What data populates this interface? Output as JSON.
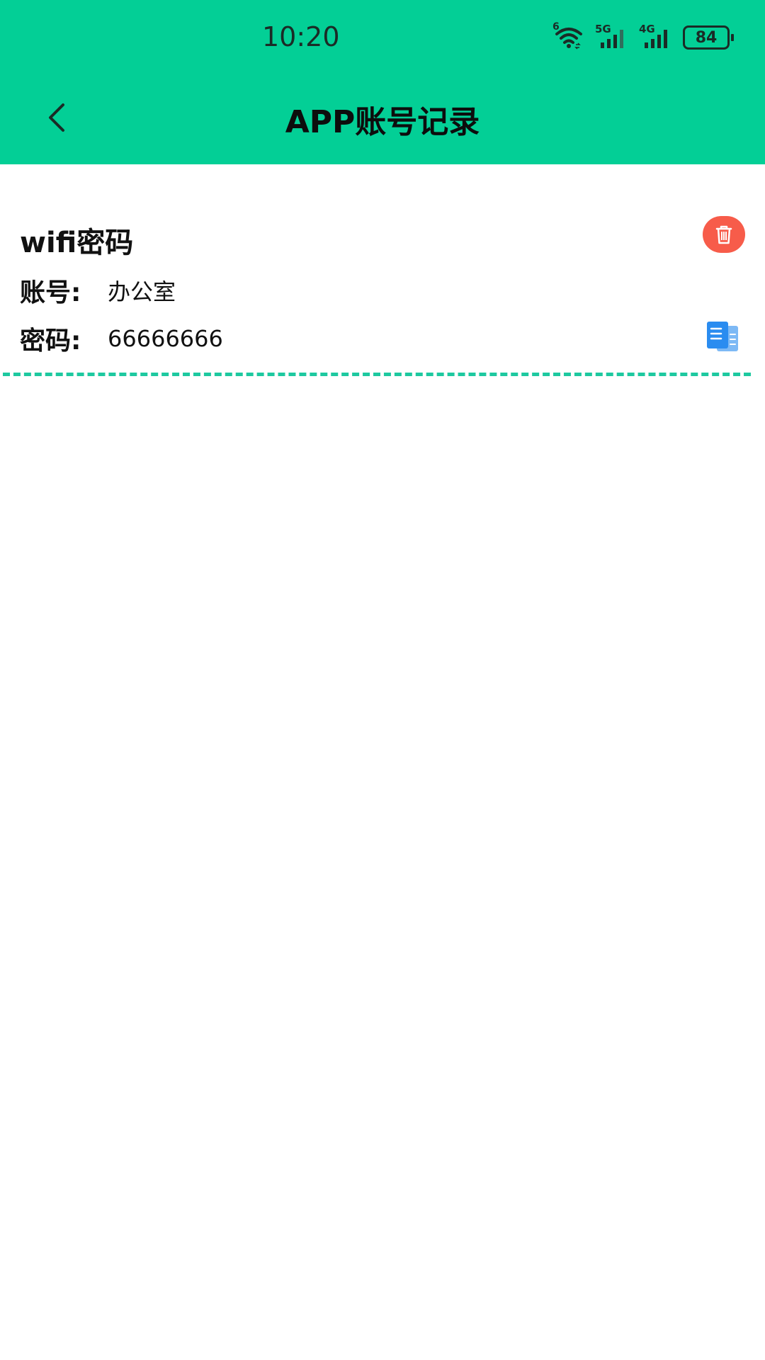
{
  "status_bar": {
    "time": "10:20",
    "wifi_badge": "6",
    "signal1_label": "5G",
    "signal2_label": "4G",
    "battery": "84",
    "icons": [
      "wifi-icon",
      "signal-5g-icon",
      "signal-4g-icon",
      "battery-icon"
    ]
  },
  "header": {
    "title": "APP账号记录",
    "back_icon": "chevron-left-icon",
    "background_color": "#03CF96"
  },
  "record": {
    "title": "wifi密码",
    "account_label": "账号:",
    "account_value": "办公室",
    "password_label": "密码:",
    "password_value": "66666666",
    "delete_icon": "trash-icon",
    "delete_color": "#F75C4A",
    "copy_icon": "copy-icon",
    "copy_color": "#2A8CF0",
    "divider_color": "#1EC9A0"
  }
}
